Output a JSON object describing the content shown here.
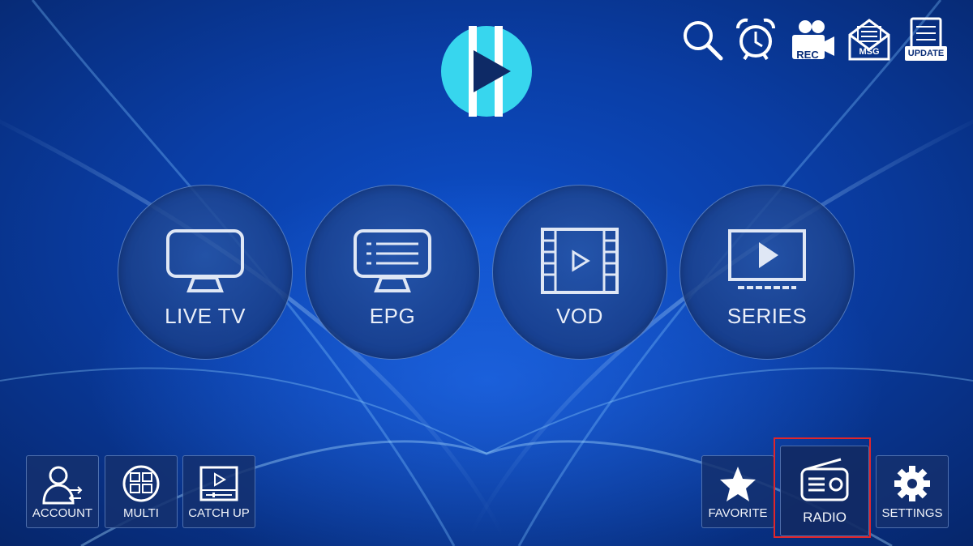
{
  "top_toolbar": {
    "rec_label": "REC",
    "msg_label": "MSG",
    "update_label": "UPDATE"
  },
  "main_menu": {
    "live_tv": "LIVE TV",
    "epg": "EPG",
    "vod": "VOD",
    "series": "SERIES"
  },
  "bottom_bar": {
    "account": "ACCOUNT",
    "multi": "MULTI",
    "catch_up": "CATCH UP",
    "favorite": "FAVORITE",
    "radio": "RADIO",
    "settings": "SETTINGS"
  },
  "colors": {
    "accent_logo": "#37d6ee",
    "highlight_border": "#e0262b",
    "background": "#0a3ea6"
  }
}
